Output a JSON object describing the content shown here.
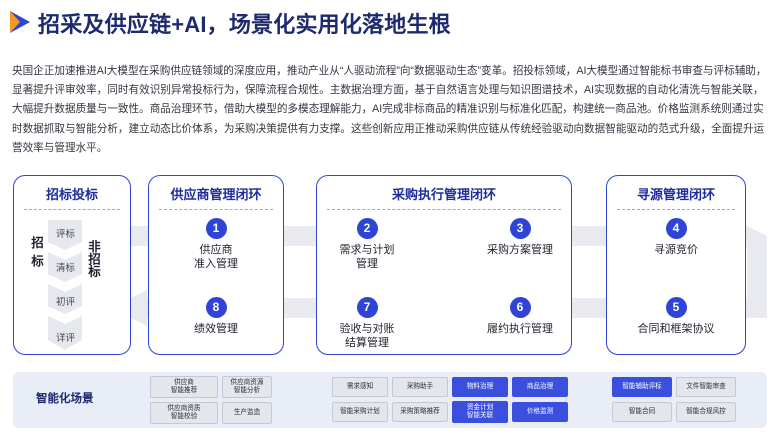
{
  "title": "招采及供应链+AI，场景化实用化落地生根",
  "intro": "央国企正加速推进AI大模型在采购供应链领域的深度应用，推动产业从“人驱动流程”向“数据驱动生态”变革。招投标领域，AI大模型通过智能标书审查与评标辅助，显著提升评审效率，同时有效识别异常投标行为，保障流程合规性。主数据治理方面，基于自然语言处理与知识图谱技术，AI实现数据的自动化清洗与智能关联，大幅提升数据质量与一致性。商品治理环节，借助大模型的多模态理解能力，AI完成非标商品的精准识别与标准化匹配，构建统一商品池。价格监测系统则通过实时数据抓取与智能分析，建立动态比价体系，为采购决策提供有力支撑。这些创新应用正推动采购供应链从传统经验驱动向数据智能驱动的范式升级，全面提升运营效率与管理水平。",
  "bidding": {
    "title": "招标投标",
    "left_label": "招标",
    "right_label": "非招标",
    "stages": [
      "评标",
      "清标",
      "初评",
      "详评"
    ]
  },
  "panels": {
    "supplier": {
      "title": "供应商管理闭环",
      "steps": [
        {
          "num": "1",
          "label": "供应商\n准入管理"
        },
        {
          "num": "8",
          "label": "绩效管理"
        }
      ]
    },
    "purchase": {
      "title": "采购执行管理闭环",
      "steps": [
        {
          "num": "2",
          "label": "需求与计划\n管理"
        },
        {
          "num": "3",
          "label": "采购方案管理"
        },
        {
          "num": "7",
          "label": "验收与对账\n结算管理"
        },
        {
          "num": "6",
          "label": "履约执行管理"
        }
      ]
    },
    "sourcing": {
      "title": "寻源管理闭环",
      "steps": [
        {
          "num": "4",
          "label": "寻源竞价"
        },
        {
          "num": "5",
          "label": "合同和框架协议"
        }
      ]
    }
  },
  "scenes": {
    "label": "智能化场景",
    "chips": [
      "供应商\n智能推荐",
      "供应商资源\n智能分析",
      "供应商资质\n智能校验",
      "生产监造",
      "需求感知",
      "采购助手",
      "物料治理",
      "商品治理",
      "智能采购计划",
      "采购策略推荐",
      "资金计划\n智能关联",
      "价格监测",
      "智能辅助评标",
      "文件智能审查",
      "智能合同",
      "智能合规风控"
    ]
  },
  "colors": {
    "accent": "#2f43d6",
    "title": "#1d2a6e",
    "chip_highlight": "#3b4fdf",
    "chip_default": "#e4e6ec",
    "flow_band": "#e8eaef"
  }
}
